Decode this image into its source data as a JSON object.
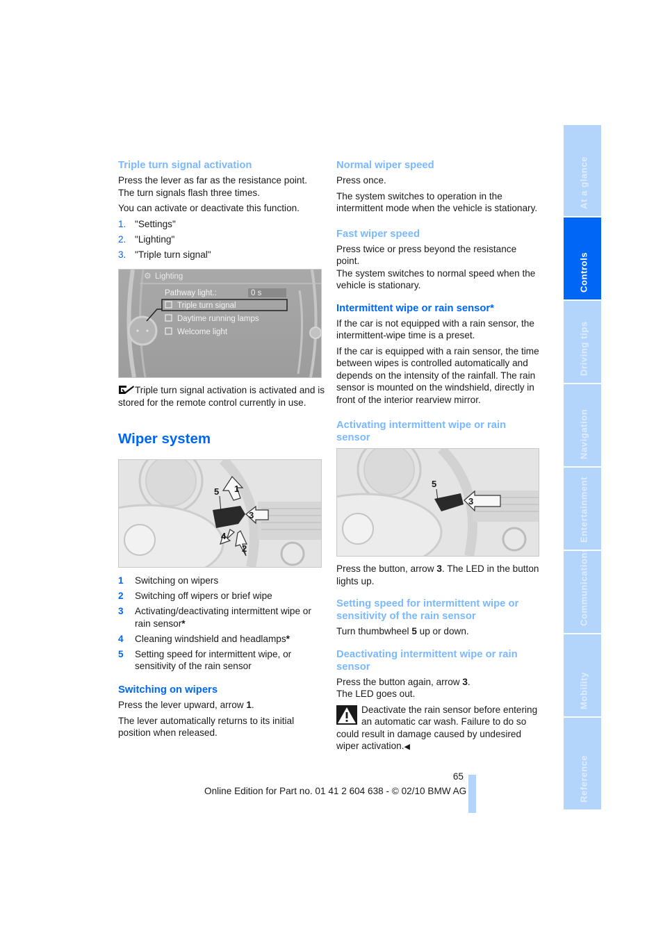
{
  "left_column": {
    "triple_turn": {
      "heading": "Triple turn signal activation",
      "p1_line1": "Press the lever as far as the resistance point.",
      "p1_line2": "The turn signals flash three times.",
      "p2": "You can activate or deactivate this function.",
      "steps": [
        {
          "num": "1.",
          "text": "\"Settings\""
        },
        {
          "num": "2.",
          "text": "\"Lighting\""
        },
        {
          "num": "3.",
          "text": "\"Triple turn signal\""
        }
      ],
      "screen": {
        "title": "Lighting",
        "pathway_label": "Pathway light.:",
        "pathway_value": "0 s",
        "options": [
          "Triple turn signal",
          "Daytime running lamps",
          "Welcome light"
        ]
      },
      "note": "Triple turn signal activation is activated and is stored for the remote control currently in use."
    },
    "wiper_system": {
      "heading": "Wiper system",
      "figure_callouts": [
        "1",
        "2",
        "3",
        "4",
        "5"
      ],
      "legend": [
        {
          "num": "1",
          "text": "Switching on wipers",
          "star": ""
        },
        {
          "num": "2",
          "text": "Switching off wipers or brief wipe",
          "star": ""
        },
        {
          "num": "3",
          "text": "Activating/deactivating intermittent wipe or rain sensor",
          "star": "*"
        },
        {
          "num": "4",
          "text": "Cleaning windshield and headlamps",
          "star": "*"
        },
        {
          "num": "5",
          "text": "Setting speed for intermittent wipe, or sensitivity of the rain sensor",
          "star": ""
        }
      ]
    },
    "switching_on": {
      "heading": "Switching on wipers",
      "p1_pre": "Press the lever upward, arrow ",
      "p1_bold": "1",
      "p1_post": ".",
      "p2": "The lever automatically returns to its initial position when released."
    }
  },
  "right_column": {
    "normal_speed": {
      "heading": "Normal wiper speed",
      "p1": "Press once.",
      "p2": "The system switches to operation in the intermittent mode when the vehicle is stationary."
    },
    "fast_speed": {
      "heading": "Fast wiper speed",
      "p1": "Press twice or press beyond the resistance point.",
      "p2": "The system switches to normal speed when the vehicle is stationary."
    },
    "intermittent": {
      "heading": "Intermittent wipe or rain sensor*",
      "p1": "If the car is not equipped with a rain sensor, the intermittent-wipe time is a preset.",
      "p2": "If the car is equipped with a rain sensor, the time between wipes is controlled automatically and depends on the intensity of the rainfall. The rain sensor is mounted on the windshield, directly in front of the interior rearview mirror."
    },
    "activating": {
      "heading": "Activating intermittent wipe or rain sensor",
      "figure_callouts": [
        "5",
        "3"
      ],
      "p1_pre": "Press the button, arrow ",
      "p1_bold": "3",
      "p1_post": ". The LED in the button lights up."
    },
    "setting_speed": {
      "heading": "Setting speed for intermittent wipe or sensitivity of the rain sensor",
      "p1_pre": "Turn thumbwheel ",
      "p1_bold": "5",
      "p1_post": " up or down."
    },
    "deactivating": {
      "heading": "Deactivating intermittent wipe or rain sensor",
      "p1_pre": "Press the button again, arrow ",
      "p1_bold": "3",
      "p1_post": ".",
      "p2": "The LED goes out.",
      "warning": "Deactivate the rain sensor before entering an automatic car wash. Failure to do so could result in damage caused by undesired wiper activation.",
      "end_mark": "◀"
    }
  },
  "side_tabs": [
    {
      "label": "At a glance",
      "active": false
    },
    {
      "label": "Controls",
      "active": true
    },
    {
      "label": "Driving tips",
      "active": false
    },
    {
      "label": "Navigation",
      "active": false
    },
    {
      "label": "Entertainment",
      "active": false
    },
    {
      "label": "Communications",
      "active": false
    },
    {
      "label": "Mobility",
      "active": false
    },
    {
      "label": "Reference",
      "active": false
    }
  ],
  "footer": {
    "page_number": "65",
    "text": "Online Edition for Part no. 01 41 2 604 638 - © 02/10 BMW AG"
  },
  "colors": {
    "heading_blue": "#0066f5",
    "subheading_light_blue": "#7ab8ff",
    "tab_inactive": "#b3d5fc",
    "tab_active": "#0066f5"
  }
}
